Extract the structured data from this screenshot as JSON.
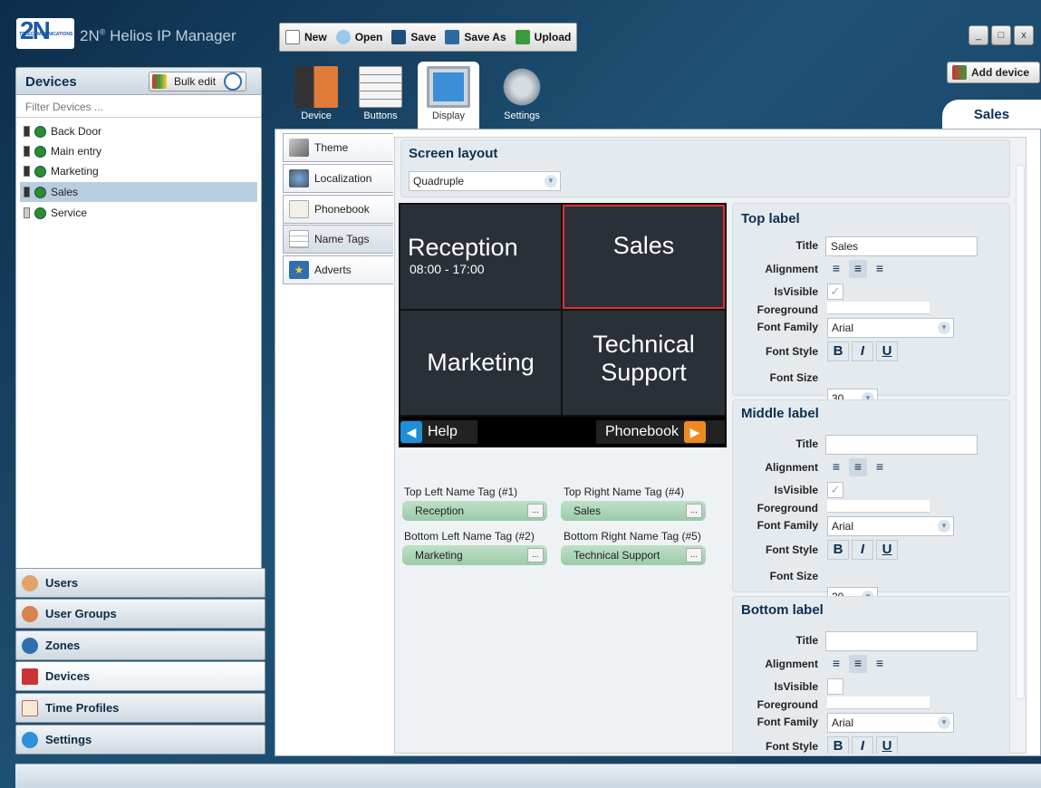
{
  "app": {
    "logo": "2N",
    "logo_sub": "TELECOMMUNICATIONS",
    "title": "Helios IP Manager",
    "title_prefix": "2N",
    "reg": "®"
  },
  "window_controls": {
    "minimize": "_",
    "maximize": "□",
    "close": "x"
  },
  "toolbar": {
    "new": "New",
    "open": "Open",
    "save": "Save",
    "save_as": "Save As",
    "upload": "Upload"
  },
  "devices_panel": {
    "title": "Devices",
    "bulk_edit": "Bulk edit",
    "filter_placeholder": "Filter Devices ...",
    "items": [
      {
        "label": "Back Door",
        "selected": false
      },
      {
        "label": "Main entry",
        "selected": false
      },
      {
        "label": "Marketing",
        "selected": false
      },
      {
        "label": "Sales",
        "selected": true
      },
      {
        "label": "Service",
        "selected": false
      }
    ]
  },
  "nav": {
    "users": "Users",
    "user_groups": "User Groups",
    "zones": "Zones",
    "devices": "Devices",
    "time_profiles": "Time Profiles",
    "settings": "Settings"
  },
  "add_device": "Add device",
  "current_device": "Sales",
  "section_tabs": {
    "device": "Device",
    "buttons": "Buttons",
    "display": "Display",
    "settings": "Settings"
  },
  "sub_tabs": {
    "theme": "Theme",
    "localization": "Localization",
    "phonebook": "Phonebook",
    "name_tags": "Name Tags",
    "adverts": "Adverts"
  },
  "screen_layout": {
    "title": "Screen layout",
    "value": "Quadruple"
  },
  "preview": {
    "top_left_title": "Reception",
    "top_left_sub": "08:00 - 17:00",
    "top_right": "Sales",
    "bottom_left": "Marketing",
    "bottom_right_1": "Technical",
    "bottom_right_2": "Support",
    "help": "Help",
    "phonebook": "Phonebook"
  },
  "name_tags": {
    "tl_label": "Top Left Name Tag (#1)",
    "tl_value": "Reception",
    "tr_label": "Top Right Name Tag (#4)",
    "tr_value": "Sales",
    "bl_label": "Bottom Left Name Tag (#2)",
    "bl_value": "Marketing",
    "br_label": "Bottom Right Name Tag (#5)",
    "br_value": "Technical Support",
    "more": "..."
  },
  "field_labels": {
    "title": "Title",
    "alignment": "Alignment",
    "is_visible": "IsVisible",
    "foreground": "Foreground",
    "font_family": "Font Family",
    "font_style": "Font Style",
    "font_size": "Font Size"
  },
  "top_label": {
    "heading": "Top label",
    "title": "Sales",
    "visible": "✓",
    "font_family": "Arial",
    "font_size": "30"
  },
  "middle_label": {
    "heading": "Middle label",
    "title": "",
    "visible": "✓",
    "font_family": "Arial",
    "font_size": "20"
  },
  "bottom_label": {
    "heading": "Bottom label",
    "title": "",
    "visible": "",
    "font_family": "Arial"
  },
  "font_buttons": {
    "bold": "B",
    "italic": "I",
    "underline": "U"
  },
  "colors": {
    "accent_blue": "#1f8fd8",
    "accent_orange": "#f08a1c",
    "tag_green": "#a8d4b4",
    "selection_red": "#e03030"
  }
}
